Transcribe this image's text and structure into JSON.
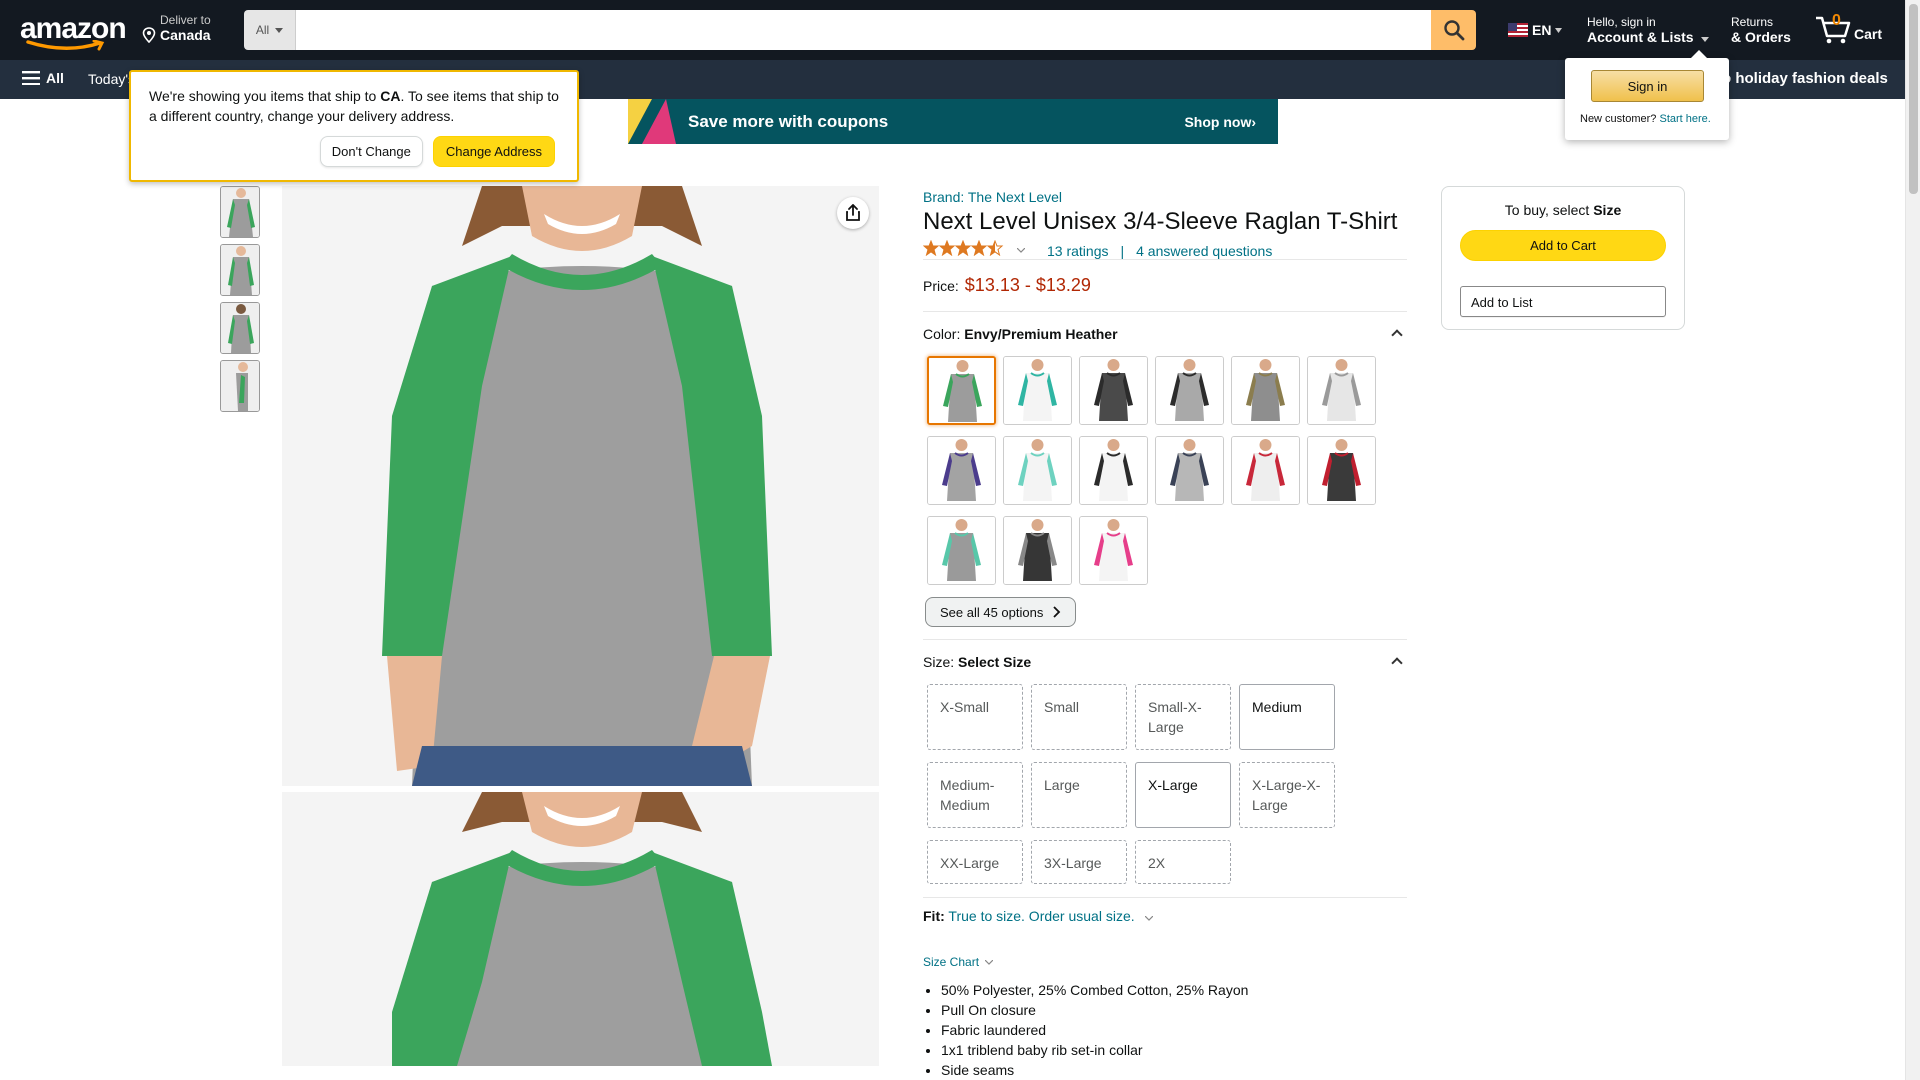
{
  "nav": {
    "logo_text": "amazon",
    "deliver_line1": "Deliver to",
    "deliver_line2": "Canada",
    "search_dept": "All",
    "search_placeholder": "",
    "lang": "EN",
    "account_line1": "Hello, sign in",
    "account_line2": "Account & Lists",
    "returns_line1": "Returns",
    "returns_line2": "& Orders",
    "cart_count": "0",
    "cart_label": "Cart"
  },
  "subnav": {
    "all_label": "All",
    "todays": "Today's",
    "promo": "o holiday fashion deals"
  },
  "banner": {
    "headline": "Save more with coupons",
    "cta": "Shop now›"
  },
  "popover": {
    "msg_part1": "We're showing you items that ship to ",
    "msg_country": "CA",
    "msg_part2": ". To see items that ship to a different country, change your delivery address.",
    "dont_change": "Don't Change",
    "change_address": "Change Address"
  },
  "signin": {
    "button": "Sign in",
    "new_customer": "New customer?",
    "start_here": "Start here."
  },
  "product": {
    "brand": "Brand: The Next Level",
    "title": "Next Level Unisex 3/4-Sleeve Raglan T-Shirt",
    "rating_value": 4.5,
    "ratings_count": "13 ratings",
    "separator": "|",
    "answered": "4 answered questions",
    "price_label": "Price:",
    "price_value": "$13.13 - $13.29",
    "color_label": "Color:",
    "color_value": "Envy/Premium Heather",
    "see_all": "See all 45 options",
    "size_label": "Size:",
    "size_value": "Select Size",
    "sizes": [
      "X-Small",
      "Small",
      "Small-X-Large",
      "Medium",
      "Medium-Medium",
      "Large",
      "X-Large",
      "X-Large-X-Large",
      "XX-Large",
      "3X-Large",
      "2X"
    ],
    "fit_label": "Fit:",
    "fit_value": "True to size. Order usual size.",
    "size_chart": "Size Chart",
    "bullets": [
      "50% Polyester, 25% Combed Cotton, 25% Rayon",
      "Pull On closure",
      "Fabric laundered",
      "1x1 triblend baby rib set-in collar",
      "Side seams"
    ]
  },
  "swatch_colors": [
    {
      "body": "#9C9C9C",
      "sleeve": "#3BA55C"
    },
    {
      "body": "#F4F4F4",
      "sleeve": "#2FB5A3"
    },
    {
      "body": "#4A4A4A",
      "sleeve": "#2B2B2B"
    },
    {
      "body": "#A9A9A9",
      "sleeve": "#2C2C2C"
    },
    {
      "body": "#8E8E8E",
      "sleeve": "#8B7D4E"
    },
    {
      "body": "#E6E6E6",
      "sleeve": "#9A9A9A"
    },
    {
      "body": "#A3A3A3",
      "sleeve": "#4B3C8C"
    },
    {
      "body": "#F4F4F4",
      "sleeve": "#6ED2C0"
    },
    {
      "body": "#F4F4F4",
      "sleeve": "#2B2B2B"
    },
    {
      "body": "#B7B7B7",
      "sleeve": "#3A4256"
    },
    {
      "body": "#EEEEEE",
      "sleeve": "#C8283A"
    },
    {
      "body": "#3A3A3A",
      "sleeve": "#C01F2F"
    },
    {
      "body": "#9A9A9A",
      "sleeve": "#58C7A9"
    },
    {
      "body": "#363636",
      "sleeve": "#888888"
    },
    {
      "body": "#F4F4F4",
      "sleeve": "#E63E8A"
    }
  ],
  "buybox": {
    "prefix": "To buy, select ",
    "bold": "Size",
    "add_to_cart": "Add to Cart",
    "add_to_list": "Add to List"
  },
  "colors": {
    "nav_bg": "#131921",
    "subnav_bg": "#232F3E",
    "accent_yellow": "#FFD814",
    "search_btn": "#FEBD69",
    "price_red": "#B12704",
    "link": "#007185",
    "star": "#DE7921",
    "selected_border": "#E77600"
  }
}
